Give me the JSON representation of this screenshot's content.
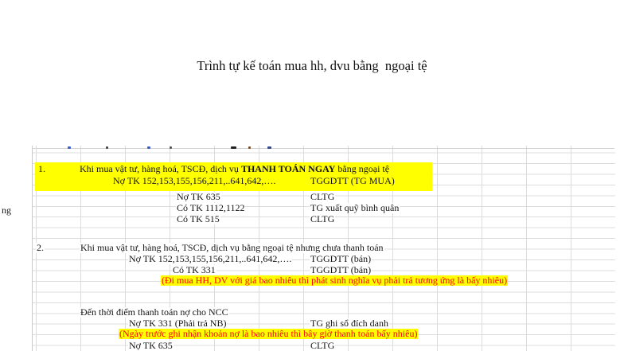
{
  "title": "Trình tự kế toán mua hh, dvu bằng  ngoại tệ",
  "colors": {
    "highlight_yellow": "#ffff00",
    "note_red": "#ff0000",
    "gridline": "#dcdcdc",
    "text": "#141414"
  },
  "margin_fragment": "ng",
  "section1": {
    "number": "1.",
    "heading_prefix": "Khi mua vật tư, hàng hoá, TSCĐ, dịch vụ ",
    "heading_bold": "THANH TOÁN NGAY",
    "heading_suffix": " bằng ngoại tệ",
    "rows": [
      {
        "account": "Nợ TK 152,153,155,156,211,..641,642,….",
        "rate": "TGGDTT (TG MUA)"
      },
      {
        "account": "Nợ TK 635",
        "rate": "CLTG"
      },
      {
        "account": "Có TK 1112,1122",
        "rate": "TG xuất quỹ bình quân"
      },
      {
        "account": "Có TK 515",
        "rate": "CLTG"
      }
    ]
  },
  "section2": {
    "number": "2.",
    "heading": "Khi mua vật tư, hàng hoá, TSCĐ, dịch vụ bằng ngoại tệ nhưng chưa thanh toán",
    "rows": [
      {
        "account": "Nợ TK 152,153,155,156,211,..641,642,….",
        "rate": "TGGDTT (bán)"
      },
      {
        "account": "Có TK 331",
        "rate": "TGGDTT (bán)"
      }
    ],
    "note1": "(Đi mua HH, DV với giá bao nhiêu thì phát sinh nghĩa vụ phải trả tương ứng là bấy nhiêu)",
    "subheading": "Đến thời điểm thanh toán nợ cho NCC",
    "rows2": [
      {
        "account": "Nợ TK 331 (Phải trả NB)",
        "rate": "TG ghi sổ đích danh"
      },
      {
        "account": "Nợ TK 635",
        "rate": "CLTG"
      }
    ],
    "note2": "(Ngày trước ghi nhận khoản nợ là bao nhiêu thì bây giờ thanh toán bấy nhiêu)"
  }
}
